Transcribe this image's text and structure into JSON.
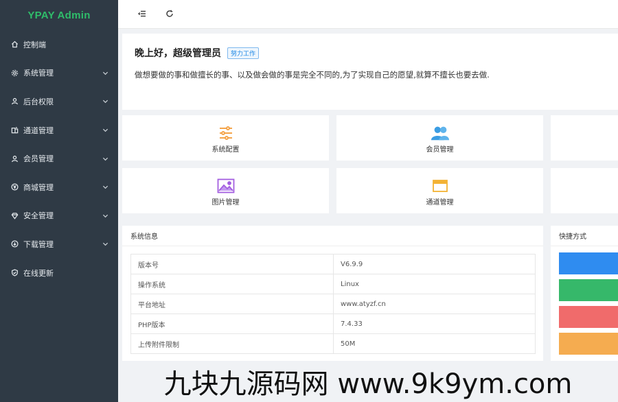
{
  "brand": {
    "title": "YPAY Admin",
    "color": "#2fbd6a"
  },
  "sidebar": {
    "items": [
      {
        "label": "控制端",
        "icon": "home-icon",
        "expandable": false
      },
      {
        "label": "系统管理",
        "icon": "gear-icon",
        "expandable": true
      },
      {
        "label": "后台权限",
        "icon": "user-icon",
        "expandable": true
      },
      {
        "label": "通道管理",
        "icon": "channel-icon",
        "expandable": true
      },
      {
        "label": "会员管理",
        "icon": "user-icon",
        "expandable": true
      },
      {
        "label": "商城管理",
        "icon": "yen-icon",
        "expandable": true
      },
      {
        "label": "安全管理",
        "icon": "diamond-icon",
        "expandable": true
      },
      {
        "label": "下载管理",
        "icon": "download-icon",
        "expandable": true
      },
      {
        "label": "在线更新",
        "icon": "shield-check-icon",
        "expandable": false
      }
    ]
  },
  "topbar": {
    "menu_toggle_icon": "menu-fold-icon",
    "refresh_icon": "refresh-icon"
  },
  "welcome": {
    "greeting": "晚上好，超级管理员",
    "badge": "努力工作",
    "motto": "做想要做的事和做擅长的事、以及做会做的事是完全不同的,为了实现自己的愿望,就算不擅长也要去做."
  },
  "shortcuts": [
    {
      "label": "系统配置",
      "icon": "sliders-icon",
      "color": "#f4a44a"
    },
    {
      "label": "会员管理",
      "icon": "users-icon",
      "color": "#3b9de3"
    },
    {
      "label": "图片管理",
      "icon": "image-icon",
      "color": "#a35ee0"
    },
    {
      "label": "通道管理",
      "icon": "window-icon",
      "color": "#f3b233"
    }
  ],
  "sysinfo": {
    "title": "系统信息",
    "rows": [
      {
        "key": "版本号",
        "value": "V6.9.9"
      },
      {
        "key": "操作系统",
        "value": "Linux"
      },
      {
        "key": "平台地址",
        "value": "www.atyzf.cn"
      },
      {
        "key": "PHP版本",
        "value": "7.4.33"
      },
      {
        "key": "上传附件限制",
        "value": "50M"
      }
    ]
  },
  "quick": {
    "title": "快捷方式",
    "colors": [
      "#2f8cf0",
      "#36b86a",
      "#f06b6b",
      "#f5ac50"
    ]
  },
  "watermark": "九块九源码网 www.9k9ym.com"
}
